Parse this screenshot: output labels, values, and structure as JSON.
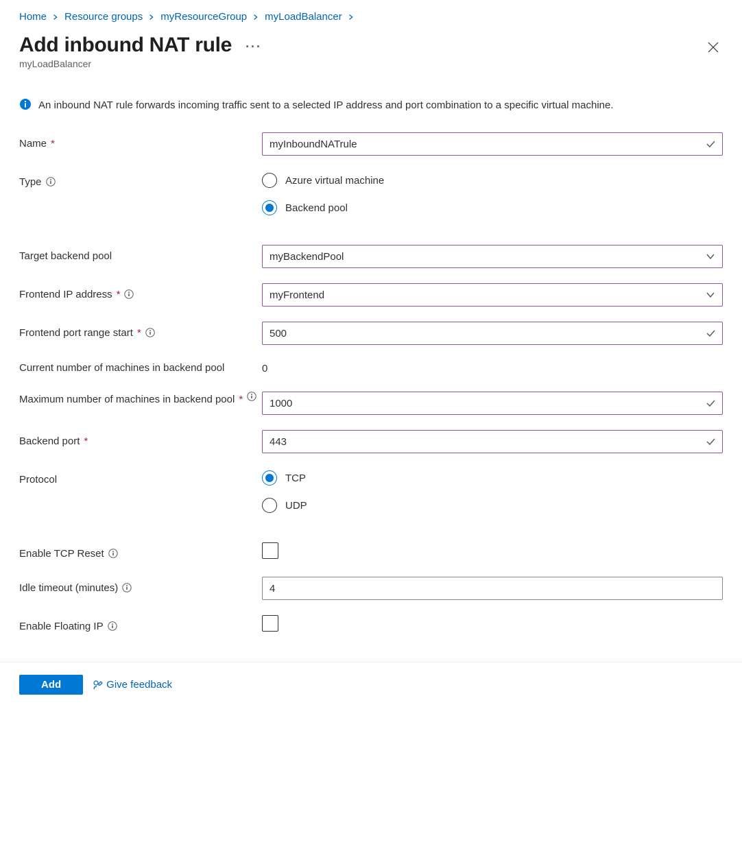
{
  "breadcrumb": {
    "items": [
      "Home",
      "Resource groups",
      "myResourceGroup",
      "myLoadBalancer"
    ]
  },
  "header": {
    "title": "Add inbound NAT rule",
    "subtitle": "myLoadBalancer"
  },
  "info_banner": "An inbound NAT rule forwards incoming traffic sent to a selected IP address and port combination to a specific virtual machine.",
  "form": {
    "name": {
      "label": "Name",
      "value": "myInboundNATrule"
    },
    "type": {
      "label": "Type",
      "options": {
        "vm": "Azure virtual machine",
        "pool": "Backend pool"
      },
      "selected": "pool"
    },
    "target_pool": {
      "label": "Target backend pool",
      "value": "myBackendPool"
    },
    "frontend_ip": {
      "label": "Frontend IP address",
      "value": "myFrontend"
    },
    "port_range_start": {
      "label": "Frontend port range start",
      "value": "500"
    },
    "current_machines": {
      "label": "Current number of machines in backend pool",
      "value": "0"
    },
    "max_machines": {
      "label": "Maximum number of machines in backend pool",
      "value": "1000"
    },
    "backend_port": {
      "label": "Backend port",
      "value": "443"
    },
    "protocol": {
      "label": "Protocol",
      "options": {
        "tcp": "TCP",
        "udp": "UDP"
      },
      "selected": "tcp"
    },
    "tcp_reset": {
      "label": "Enable TCP Reset",
      "checked": false
    },
    "idle_timeout": {
      "label": "Idle timeout (minutes)",
      "value": "4"
    },
    "floating_ip": {
      "label": "Enable Floating IP",
      "checked": false
    }
  },
  "footer": {
    "add": "Add",
    "feedback": "Give feedback"
  }
}
